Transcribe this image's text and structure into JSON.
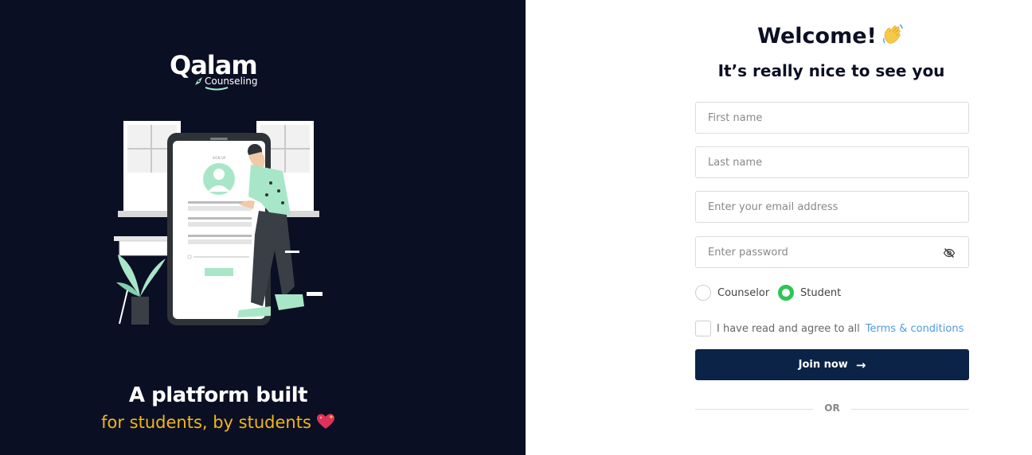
{
  "brand": {
    "name": "Qalam",
    "subname": "Counseling",
    "colors": {
      "panel_bg": "#0b0f24",
      "accent_mint": "#a8e6c8",
      "tagline_yellow": "#f2b619",
      "button_navy": "#0c2348",
      "radio_green": "#2ec458",
      "link_blue": "#4f9be0"
    }
  },
  "left_panel": {
    "illustration": "person-using-phone-signup-illustration",
    "tagline_main": "A platform built",
    "tagline_sub": "for students, by students",
    "tagline_emoji": "sparkling-heart-emoji"
  },
  "form": {
    "title": "Welcome!",
    "title_emoji": "waving-hand-emoji",
    "subtitle": "It’s really nice to see you",
    "fields": {
      "first_name": {
        "placeholder": "First name",
        "value": ""
      },
      "last_name": {
        "placeholder": "Last name",
        "value": ""
      },
      "email": {
        "placeholder": "Enter your email address",
        "value": ""
      },
      "password": {
        "placeholder": "Enter password",
        "value": "",
        "toggle_icon": "eye-off-icon"
      }
    },
    "role_options": [
      {
        "label": "Counselor",
        "selected": false
      },
      {
        "label": "Student",
        "selected": true
      }
    ],
    "agree_text": "I have read and agree to all",
    "agree_link": "Terms & conditions",
    "agree_checked": false,
    "submit_label": "Join now",
    "submit_icon": "arrow-right-icon",
    "divider_text": "OR"
  }
}
